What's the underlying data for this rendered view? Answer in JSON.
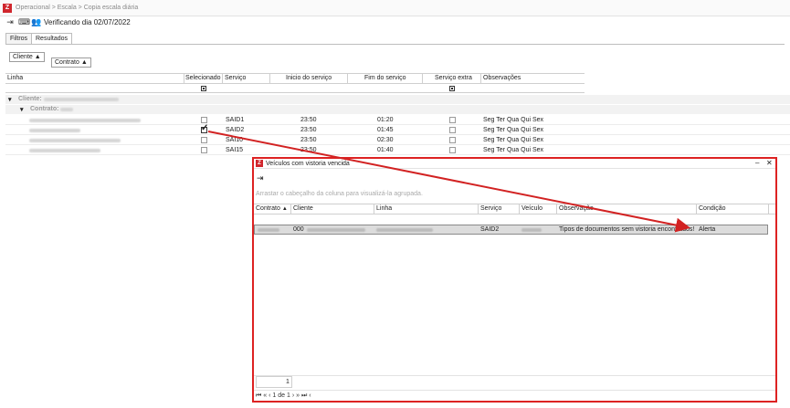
{
  "app": {
    "breadcrumb": "Operacional > Escala > Copia escala diária",
    "toolbar_title": "Verificando dia 02/07/2022"
  },
  "tabs": [
    "Filtros",
    "Resultados"
  ],
  "group_chips": [
    "Cliente",
    "Contrato"
  ],
  "grid": {
    "columns": [
      "Linha",
      "Selecionado",
      "Serviço",
      "Inicio do serviço",
      "Fim do serviço",
      "Serviço extra",
      "Observações"
    ],
    "group_client_label": "Cliente:",
    "group_contract_label": "Contrato:",
    "rows": [
      {
        "service": "SAID1",
        "start": "23:50",
        "end": "01:20",
        "checked": false,
        "obs": "Seg Ter Qua Qui Sex"
      },
      {
        "service": "SAID2",
        "start": "23:50",
        "end": "01:45",
        "checked": true,
        "obs": "Seg Ter Qua Qui Sex"
      },
      {
        "service": "SAI10",
        "start": "23:50",
        "end": "02:30",
        "checked": false,
        "obs": "Seg Ter Qua Qui Sex"
      },
      {
        "service": "SAI15",
        "start": "23:50",
        "end": "01:40",
        "checked": false,
        "obs": "Seg Ter Qua Qui Sex"
      }
    ]
  },
  "dialog": {
    "title": "Veículos com vistoria vencida",
    "group_hint": "Arrastar o cabeçalho da coluna para visualizá-la agrupada.",
    "columns": [
      "Contrato",
      "Cliente",
      "Linha",
      "Serviço",
      "Veículo",
      "Observação",
      "Condição"
    ],
    "row": {
      "client": "000",
      "service": "SAID2",
      "observation": "Tipos de documentos sem vistoria encontrados!",
      "condition": "Alerta"
    },
    "pager_count": "1",
    "pager_text": "1 de 1"
  },
  "colors": {
    "accent_red": "#d22222",
    "brand_red": "#d0262d"
  }
}
